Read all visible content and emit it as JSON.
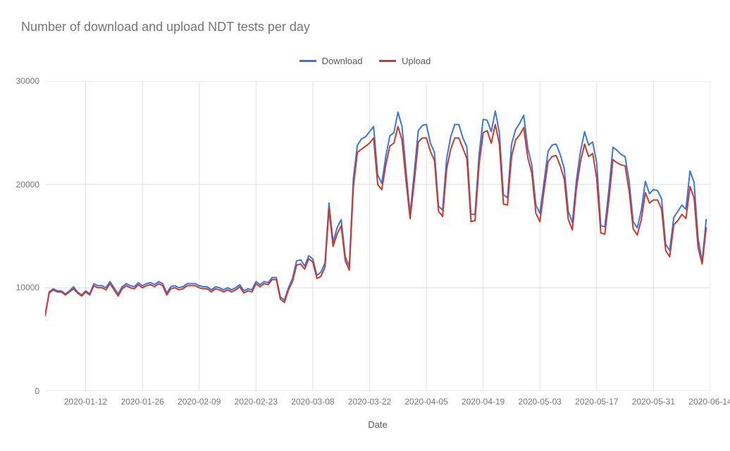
{
  "chart_data": {
    "type": "line",
    "title": "Number of download and upload NDT tests per day",
    "xlabel": "Date",
    "ylabel": "",
    "ylim": [
      0,
      30000
    ],
    "yticks": [
      0,
      10000,
      20000,
      30000
    ],
    "xticks": [
      "2020-01-12",
      "2020-01-26",
      "2020-02-09",
      "2020-02-23",
      "2020-03-08",
      "2020-03-22",
      "2020-04-05",
      "2020-04-19",
      "2020-05-03",
      "2020-05-17",
      "2020-05-31",
      "2020-06-14"
    ],
    "x_start": "2020-01-02",
    "x_end": "2020-06-14",
    "x_days": 164,
    "legend": [
      {
        "name": "Download",
        "color": "#3b77db"
      },
      {
        "name": "Upload",
        "color": "#cc3a2d"
      }
    ],
    "series": [
      {
        "name": "Download",
        "color": "#3b77db",
        "values": [
          7300,
          9600,
          9900,
          9700,
          9700,
          9400,
          9700,
          10100,
          9600,
          9300,
          9700,
          9400,
          10400,
          10200,
          10200,
          10000,
          10600,
          10000,
          9400,
          10100,
          10400,
          10200,
          10100,
          10500,
          10200,
          10400,
          10500,
          10300,
          10600,
          10400,
          9500,
          10100,
          10200,
          10000,
          10100,
          10400,
          10400,
          10400,
          10200,
          10100,
          10100,
          9800,
          10100,
          10000,
          9800,
          10000,
          9800,
          10000,
          10300,
          9700,
          9900,
          9800,
          10600,
          10300,
          10600,
          10500,
          11000,
          11000,
          9100,
          8800,
          10000,
          10900,
          12600,
          12700,
          12100,
          13100,
          12800,
          11200,
          11500,
          12400,
          18200,
          14400,
          15800,
          16600,
          13000,
          12100,
          20600,
          23800,
          24400,
          24600,
          25100,
          25600,
          20900,
          20100,
          22700,
          24700,
          25000,
          27000,
          25600,
          21300,
          17100,
          21100,
          25200,
          25700,
          25800,
          24000,
          23100,
          17900,
          17500,
          22500,
          24600,
          25800,
          25800,
          24500,
          23600,
          17100,
          17100,
          22900,
          26300,
          26200,
          25100,
          27100,
          25000,
          19000,
          18700,
          23900,
          25300,
          25900,
          26700,
          23500,
          21900,
          18000,
          17200,
          20200,
          23200,
          23800,
          23900,
          22900,
          21500,
          17400,
          16300,
          20400,
          23200,
          25100,
          23800,
          24100,
          22100,
          16000,
          15900,
          19500,
          23600,
          23300,
          22900,
          22700,
          20300,
          16400,
          15800,
          17500,
          20300,
          19100,
          19500,
          19400,
          18600,
          14200,
          13600,
          16800,
          17400,
          18000,
          17600,
          21300,
          20200,
          14800,
          12500,
          16600
        ]
      },
      {
        "name": "Upload",
        "color": "#cc3a2d",
        "values": [
          7300,
          9500,
          9800,
          9600,
          9600,
          9300,
          9600,
          9900,
          9500,
          9200,
          9600,
          9300,
          10200,
          10000,
          10000,
          9800,
          10400,
          9800,
          9200,
          9900,
          10200,
          10000,
          9900,
          10300,
          10000,
          10200,
          10300,
          10100,
          10400,
          10200,
          9300,
          9900,
          10000,
          9800,
          9900,
          10200,
          10200,
          10200,
          10000,
          9900,
          9900,
          9600,
          9900,
          9800,
          9600,
          9800,
          9600,
          9800,
          10100,
          9500,
          9700,
          9600,
          10400,
          10100,
          10400,
          10300,
          10800,
          10800,
          8900,
          8600,
          9800,
          10600,
          12200,
          12300,
          11800,
          12800,
          12500,
          10900,
          11100,
          12000,
          17600,
          14000,
          15200,
          16000,
          12600,
          11700,
          19800,
          23100,
          23400,
          23700,
          24000,
          24500,
          20000,
          19500,
          21900,
          23700,
          24000,
          25600,
          24300,
          20300,
          16700,
          20200,
          24100,
          24500,
          24500,
          23200,
          22300,
          17400,
          16900,
          21500,
          23400,
          24500,
          24500,
          23500,
          22500,
          16400,
          16500,
          21900,
          25000,
          25200,
          24000,
          25800,
          23900,
          18100,
          18000,
          22700,
          24300,
          24800,
          25500,
          22600,
          21100,
          17200,
          16400,
          19400,
          22200,
          22700,
          22800,
          21800,
          20500,
          16600,
          15600,
          19600,
          22200,
          23900,
          22700,
          23000,
          20600,
          15300,
          15200,
          18500,
          22400,
          22100,
          21900,
          21800,
          19300,
          15700,
          15100,
          16600,
          19200,
          18200,
          18500,
          18500,
          17600,
          13600,
          13000,
          16100,
          16500,
          17100,
          16700,
          19800,
          18700,
          13900,
          12300,
          15800
        ]
      }
    ]
  }
}
